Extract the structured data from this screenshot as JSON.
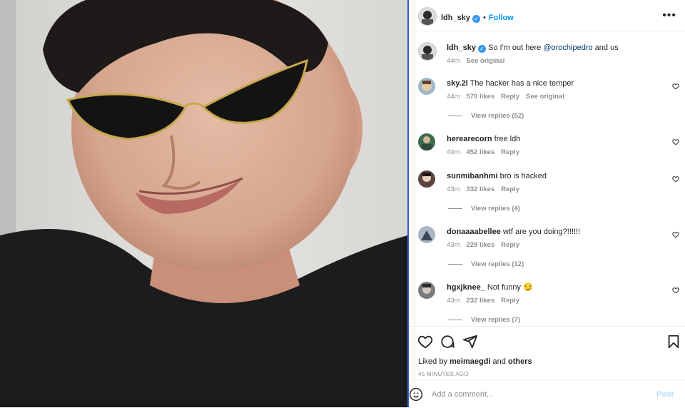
{
  "header": {
    "username": "ldh_sky",
    "separator": "•",
    "follow_label": "Follow",
    "more_icon": "more-horizontal-icon"
  },
  "caption": {
    "username": "ldh_sky",
    "text_before": "So I'm out here ",
    "mention": "@orochipedro",
    "text_after": " and us",
    "time": "44m",
    "see_original": "See original"
  },
  "comments": [
    {
      "username": "sky.2l",
      "text": "The hacker has a nice temper",
      "time": "44m",
      "likes": "570 likes",
      "reply": "Reply",
      "see_original": "See original",
      "view_replies": "View replies (52)",
      "avatar_color": "#9fb8c8"
    },
    {
      "username": "herearecorn",
      "text": "free ldh",
      "time": "44m",
      "likes": "452 likes",
      "reply": "Reply",
      "view_replies": "",
      "avatar_color": "#3f6b4c"
    },
    {
      "username": "sunmibanhmi",
      "text": "bro is hacked",
      "time": "43m",
      "likes": "332 likes",
      "reply": "Reply",
      "view_replies": "View replies (4)",
      "avatar_color": "#5a4540"
    },
    {
      "username": "donaaaabellee",
      "text": "wtf are you doing?!!!!!!",
      "time": "43m",
      "likes": "229 likes",
      "reply": "Reply",
      "view_replies": "View replies (12)",
      "avatar_color": "#a7b6c4"
    },
    {
      "username": "hgxjknee_",
      "text": "Not funny 😏",
      "time": "43m",
      "likes": "232 likes",
      "reply": "Reply",
      "view_replies": "View replies (7)",
      "avatar_color": "#7a7a78"
    }
  ],
  "actions": {
    "like_icon": "heart-icon",
    "comment_icon": "comment-icon",
    "share_icon": "share-icon",
    "save_icon": "bookmark-icon",
    "liked_by_prefix": "Liked by ",
    "liked_by_user": "meimaegdi",
    "liked_by_and": " and ",
    "liked_by_others": "others",
    "timestamp": "45 MINUTES AGO"
  },
  "add_comment": {
    "emoji_icon": "emoji-icon",
    "placeholder": "Add a comment...",
    "post_label": "Post"
  },
  "colors": {
    "accent": "#0095f6",
    "verified": "#3897f0",
    "post_disabled": "#b2dffc",
    "secondary_text": "#8e8e8e"
  }
}
